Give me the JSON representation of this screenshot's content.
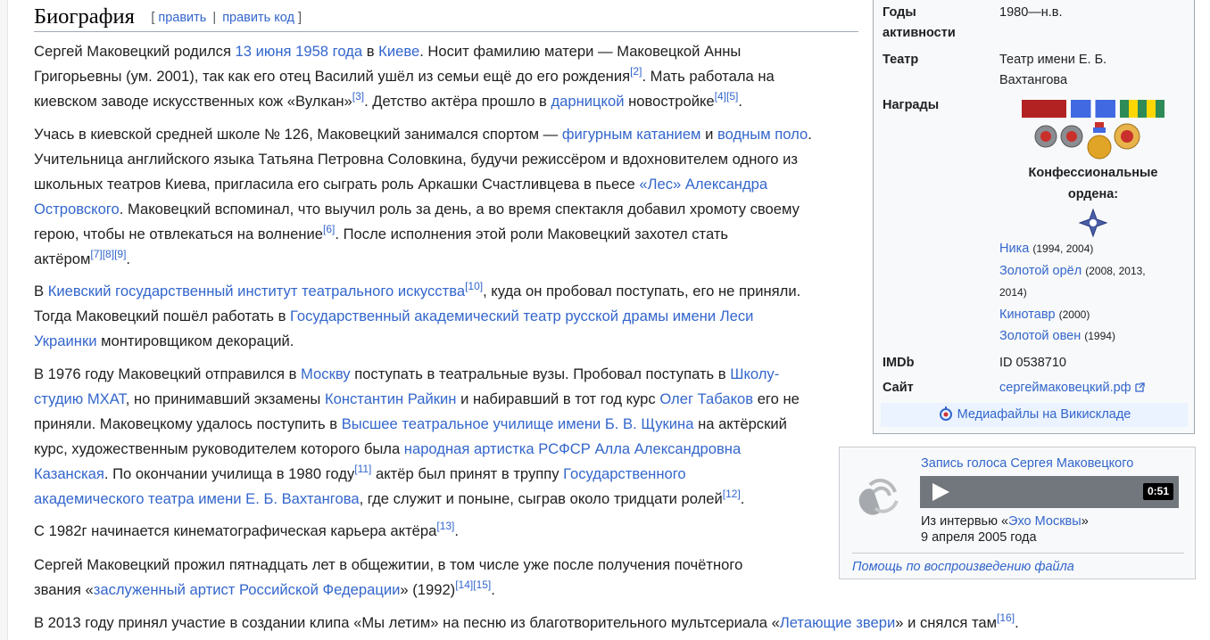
{
  "section": {
    "title": "Биография",
    "edit_label": "править",
    "edit_code_label": "править код",
    "bracket_open": "[",
    "bracket_close": "]",
    "separator": "|"
  },
  "paragraphs": [
    [
      {
        "t": "Сергей Маковецкий родился "
      },
      {
        "t": "13 июня",
        "link": true
      },
      {
        "t": " "
      },
      {
        "t": "1958 года",
        "link": true
      },
      {
        "t": " в "
      },
      {
        "t": "Киеве",
        "link": true
      },
      {
        "t": ". Носит фамилию матери — Маковецкой Анны"
      },
      {
        "br": true
      },
      {
        "t": "Григорьевны (ум. 2001), так как его отец Василий ушёл из семьи ещё до его рождения"
      },
      {
        "t": "[2]",
        "sup": true
      },
      {
        "t": ". Мать работала на"
      },
      {
        "br": true
      },
      {
        "t": "киевском заводе искусственных кож «Вулкан»"
      },
      {
        "t": "[3]",
        "sup": true
      },
      {
        "t": ". Детство актёра прошло в "
      },
      {
        "t": "дарницкой",
        "link": true
      },
      {
        "t": " новостройке"
      },
      {
        "t": "[4]",
        "sup": true
      },
      {
        "t": "[5]",
        "sup": true
      },
      {
        "t": "."
      }
    ],
    [
      {
        "t": "Учась в киевской средней школе № 126, Маковецкий занимался спортом — "
      },
      {
        "t": "фигурным катанием",
        "link": true
      },
      {
        "t": " и "
      },
      {
        "t": "водным поло",
        "link": true
      },
      {
        "t": "."
      },
      {
        "br": true
      },
      {
        "t": "Учительница английского языка Татьяна Петровна Соловкина, будучи режиссёром и вдохновителем одного из"
      },
      {
        "br": true
      },
      {
        "t": "школьных театров Киева, пригласила его сыграть роль Аркашки Счастливцева в пьесе "
      },
      {
        "t": "«Лес» Александра",
        "link": true
      },
      {
        "br": true
      },
      {
        "t": "Островского",
        "link": true
      },
      {
        "t": ". Маковецкий вспоминал, что выучил роль за день, а во время спектакля добавил хромоту своему"
      },
      {
        "br": true
      },
      {
        "t": "герою, чтобы не отвлекаться на волнение"
      },
      {
        "t": "[6]",
        "sup": true
      },
      {
        "t": ". После исполнения этой роли Маковецкий захотел стать"
      },
      {
        "br": true
      },
      {
        "t": "актёром"
      },
      {
        "t": "[7]",
        "sup": true
      },
      {
        "t": "[8]",
        "sup": true
      },
      {
        "t": "[9]",
        "sup": true
      },
      {
        "t": "."
      }
    ],
    [
      {
        "t": "В "
      },
      {
        "t": "Киевский государственный институт театрального искусства",
        "link": true
      },
      {
        "t": "[10]",
        "sup": true
      },
      {
        "t": ", куда он пробовал поступать, его не приняли."
      },
      {
        "br": true
      },
      {
        "t": "Тогда Маковецкий пошёл работать в "
      },
      {
        "t": "Государственный академический театр русской драмы имени Леси",
        "link": true
      },
      {
        "br": true
      },
      {
        "t": "Украинки",
        "link": true
      },
      {
        "t": " монтировщиком декораций."
      }
    ],
    [
      {
        "t": "В 1976 году Маковецкий отправился в "
      },
      {
        "t": "Москву",
        "link": true
      },
      {
        "t": " поступать в театральные вузы. Пробовал поступать в "
      },
      {
        "t": "Школу-",
        "link": true
      },
      {
        "br": true
      },
      {
        "t": "студию МХАТ",
        "link": true
      },
      {
        "t": ", но принимавший экзамены "
      },
      {
        "t": "Константин Райкин",
        "link": true
      },
      {
        "t": " и набиравший в тот год курс "
      },
      {
        "t": "Олег Табаков",
        "link": true
      },
      {
        "t": " его не"
      },
      {
        "br": true
      },
      {
        "t": "приняли. Маковецкому удалось поступить в "
      },
      {
        "t": "Высшее театральное училище имени Б. В. Щукина",
        "link": true
      },
      {
        "t": " на актёрский"
      },
      {
        "br": true
      },
      {
        "t": "курс, художественным руководителем которого была "
      },
      {
        "t": "народная артистка РСФСР",
        "link": true
      },
      {
        "t": " "
      },
      {
        "t": "Алла Александровна",
        "link": true
      },
      {
        "br": true
      },
      {
        "t": "Казанская",
        "link": true
      },
      {
        "t": ". По окончании училища в 1980 году"
      },
      {
        "t": "[11]",
        "sup": true
      },
      {
        "t": " актёр был принят в труппу "
      },
      {
        "t": "Государственного",
        "link": true
      },
      {
        "br": true
      },
      {
        "t": "академического театра имени Е. Б. Вахтангова",
        "link": true
      },
      {
        "t": ", где служит и поныне, сыграв около тридцати ролей"
      },
      {
        "t": "[12]",
        "sup": true
      },
      {
        "t": "."
      }
    ],
    [
      {
        "t": "С 1982г начинается кинематографическая карьера актёра"
      },
      {
        "t": "[13]",
        "sup": true
      },
      {
        "t": "."
      }
    ],
    [
      {
        "t": "Сергей Маковецкий прожил пятнадцать лет в общежитии, в том числе уже после получения почётного"
      },
      {
        "br": true
      },
      {
        "t": "звания «"
      },
      {
        "t": "заслуженный артист Российской Федерации",
        "link": true
      },
      {
        "t": "» (1992)"
      },
      {
        "t": "[14]",
        "sup": true
      },
      {
        "t": "[15]",
        "sup": true
      },
      {
        "t": "."
      }
    ],
    [
      {
        "t": "В 2013 году принял участие в создании клипа «Мы летим» на песню из благотворительного мультсериала «"
      },
      {
        "t": "Летающие звери",
        "link": true
      },
      {
        "t": "» и снялся там"
      },
      {
        "t": "[16]",
        "sup": true
      },
      {
        "t": "."
      }
    ]
  ],
  "infobox": {
    "years_label_1": "Годы",
    "years_label_2": "активности",
    "years_value": "1980—н.в.",
    "theatre_label": "Театр",
    "theatre_value_1": "Театр имени Е. Б.",
    "theatre_value_2": "Вахтангова",
    "awards_label": "Награды",
    "ribbon_colors": [
      "#b22222",
      "#4169e1",
      "#2e8b57"
    ],
    "medal_icons": [
      "order-medal-icon",
      "order-medal-icon",
      "state-prize-medal-icon",
      "order-star-icon"
    ],
    "confessional_1": "Конфессиональные",
    "confessional_2": "ордена:",
    "confessional_icon": "church-order-cross-icon",
    "prizes": [
      {
        "name": "Ника",
        "years": "(1994, 2004)"
      },
      {
        "name": "Золотой орёл",
        "years": "(2008, 2013,"
      },
      {
        "name": "",
        "years": "2014)"
      },
      {
        "name": "Кинотавр",
        "years": "(2000)"
      },
      {
        "name": "Золотой овен",
        "years": "(1994)"
      }
    ],
    "imdb_label": "IMDb",
    "imdb_value": "ID 0538710",
    "site_label": "Сайт",
    "site_value": "сергеймаковецкий.рф",
    "commons_label": "Медиафайлы на Викискладе"
  },
  "audio": {
    "title": "Запись голоса Сергея Маковецкого",
    "duration": "0:51",
    "caption_prefix": "Из интервью «",
    "caption_link": "Эхо Москвы",
    "caption_suffix": "»",
    "date": "9 апреля 2005 года",
    "help": "Помощь по воспроизведению файла"
  }
}
